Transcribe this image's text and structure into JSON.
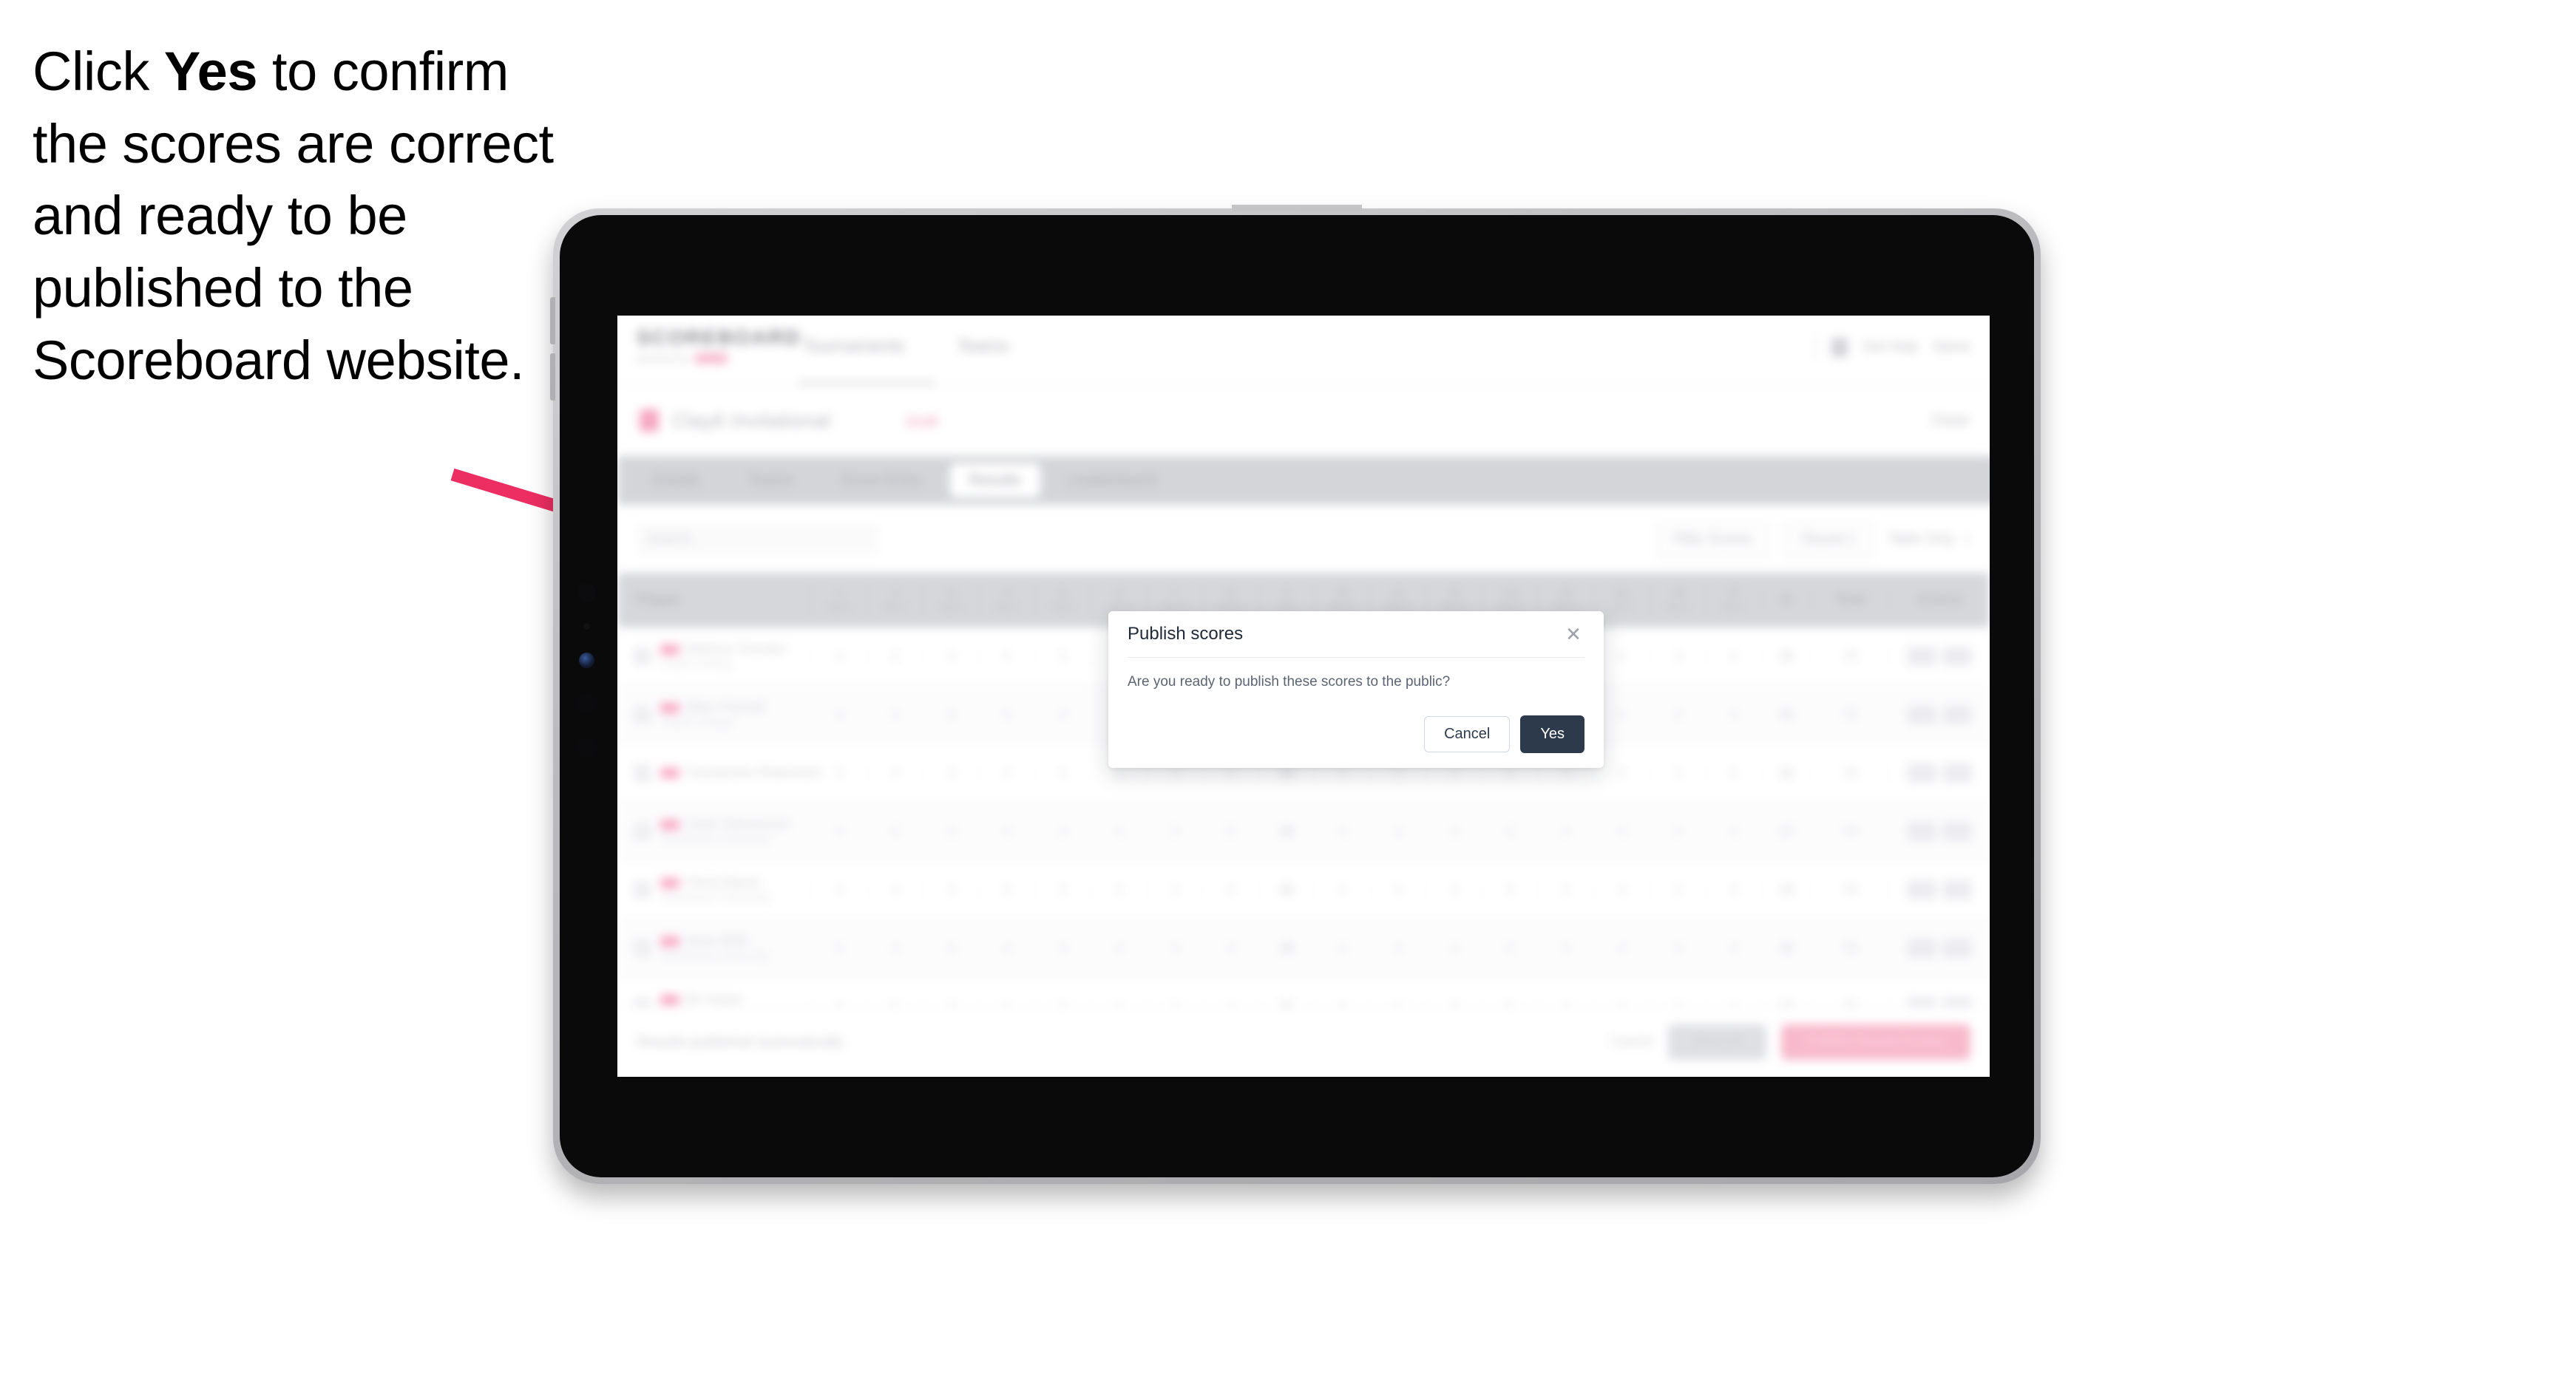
{
  "callout": {
    "line_start": "Click ",
    "emphasis": "Yes",
    "line_rest": " to confirm the scores are correct and ready to be published to the Scoreboard website."
  },
  "colors": {
    "arrow": "#ED2E63",
    "primary_button": "#2C3A4B",
    "brand_pink": "#F6A7C2",
    "tabbar": "#D4D5D9"
  },
  "device": {
    "type": "tablet",
    "frame_color": "#B9B9BC",
    "screen_background": "#FFFFFF"
  },
  "app": {
    "header": {
      "logo": "SCOREBOARD",
      "logo_tagline": "powered by",
      "nav": [
        "Tournaments",
        "Teams"
      ],
      "right_items": [
        "Get Help",
        "Name"
      ],
      "icon": "user-avatar-icon"
    },
    "title_strip": {
      "title": "Clay6 Invitational",
      "meta": "Draft",
      "right_action": "Close"
    },
    "tabs": [
      {
        "label": "Details",
        "active": false
      },
      {
        "label": "Teams",
        "active": false
      },
      {
        "label": "Score Entry",
        "active": false
      },
      {
        "label": "Results",
        "active": true
      },
      {
        "label": "Leaderboard",
        "active": false
      }
    ],
    "filters": {
      "search_placeholder": "Search",
      "pills": [
        "Filter Scores",
        "Round 1"
      ],
      "plain": "Table Only"
    },
    "table": {
      "player_header": "Player",
      "hole_headers": [
        {
          "num": "1",
          "par": "Par 4"
        },
        {
          "num": "2",
          "par": "Par 4"
        },
        {
          "num": "3",
          "par": "Par 3"
        },
        {
          "num": "4",
          "par": "Par 5"
        },
        {
          "num": "5",
          "par": "Par 4"
        },
        {
          "num": "6",
          "par": "Par 4"
        },
        {
          "num": "7",
          "par": "Par 3"
        },
        {
          "num": "8",
          "par": "Par 4"
        },
        {
          "num": "9",
          "par": "Out"
        },
        {
          "num": "10",
          "par": "Par 4"
        },
        {
          "num": "11",
          "par": "Par 4"
        },
        {
          "num": "12",
          "par": "Par 3"
        },
        {
          "num": "13",
          "par": "Par 5"
        },
        {
          "num": "14",
          "par": "Par 4"
        },
        {
          "num": "15",
          "par": "Par 4"
        },
        {
          "num": "16",
          "par": "Par 3"
        },
        {
          "num": "17",
          "par": "Par 4"
        },
        {
          "num": "18",
          "par": "In"
        }
      ],
      "end_headers": [
        "In",
        "Total",
        "Actions"
      ],
      "rows": [
        {
          "player": "Melissa Tomoko",
          "club": "Clay6 College",
          "scores": [
            "4",
            "5",
            "3",
            "4",
            "5",
            "4",
            "3",
            "4",
            "36",
            "4",
            "4",
            "3",
            "5",
            "4",
            "4",
            "3",
            "4"
          ],
          "sub": "36",
          "total": "72",
          "score_to_par": "+2"
        },
        {
          "player": "Ellen Parnell",
          "club": "Clay6 College",
          "scores": [
            "4",
            "4",
            "3",
            "5",
            "4",
            "4",
            "3",
            "4",
            "36",
            "4",
            "5",
            "3",
            "5",
            "4",
            "4",
            "3",
            "4"
          ],
          "sub": "36",
          "total": "72",
          "score_to_par": "+1"
        },
        {
          "player": "Cassandra Robertson",
          "club": "",
          "scores": [
            "5",
            "4",
            "3",
            "4",
            "4",
            "5",
            "3",
            "4",
            "36",
            "4",
            "4",
            "3",
            "5",
            "4",
            "4",
            "3",
            "5"
          ],
          "sub": "36",
          "total": "73",
          "score_to_par": "+3"
        },
        {
          "player": "Clare Stevenson",
          "club": "Southwest University",
          "scores": [
            "4",
            "5",
            "3",
            "4",
            "4",
            "4",
            "3",
            "5",
            "36",
            "4",
            "4",
            "3",
            "5",
            "4",
            "4",
            "3",
            "4"
          ],
          "sub": "37",
          "total": "74",
          "score_to_par": "+2"
        },
        {
          "player": "Olivia Baum",
          "club": "Southwest University",
          "scores": [
            "4",
            "4",
            "3",
            "5",
            "4",
            "4",
            "3",
            "4",
            "35",
            "4",
            "5",
            "3",
            "5",
            "4",
            "4",
            "3",
            "4"
          ],
          "sub": "36",
          "total": "74",
          "score_to_par": "+3"
        },
        {
          "player": "Nora Wild",
          "club": "Southwest University",
          "scores": [
            "5",
            "4",
            "3",
            "4",
            "4",
            "4",
            "3",
            "4",
            "36",
            "4",
            "4",
            "3",
            "5",
            "4",
            "4",
            "3",
            "4"
          ],
          "sub": "36",
          "total": "75",
          "score_to_par": "+4"
        },
        {
          "player": "Bri Nolan",
          "club": "Southwest University",
          "scores": [
            "4",
            "5",
            "3",
            "4",
            "5",
            "4",
            "3",
            "4",
            "36",
            "4",
            "4",
            "3",
            "5",
            "4",
            "4",
            "3",
            "4"
          ],
          "sub": "36",
          "total": "75",
          "score_to_par": "+4"
        }
      ]
    },
    "bottom_bar": {
      "note": "Results published automatically",
      "link": "Cancel",
      "secondary_button": "Save All",
      "primary_button": "Publish Round Scores"
    }
  },
  "modal": {
    "title": "Publish scores",
    "close_icon": "close-icon",
    "message": "Are you ready to publish these scores to the public?",
    "cancel_label": "Cancel",
    "confirm_label": "Yes"
  }
}
